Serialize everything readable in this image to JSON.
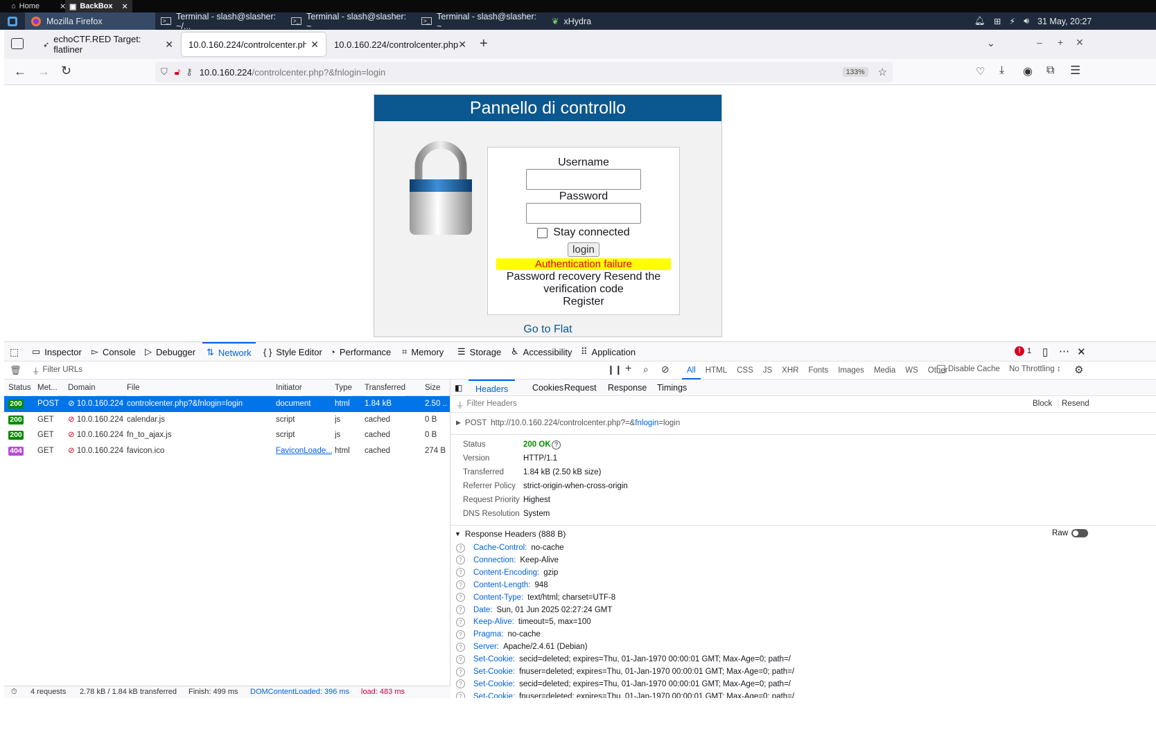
{
  "topstrip": {
    "tab1": "Home",
    "tab2": "BackBox"
  },
  "taskbar": {
    "tasks": [
      "Mozilla Firefox",
      "Terminal - slash@slasher: ~/...",
      "Terminal - slash@slasher: ~",
      "Terminal - slash@slasher: ~",
      "xHydra"
    ],
    "clock": "31 May, 20:27"
  },
  "browser": {
    "tabs": [
      "echoCTF.RED Target: flatliner",
      "10.0.160.224/controlcenter.php?&",
      "10.0.160.224/controlcenter.php"
    ],
    "url_host": "10.0.160.224",
    "url_path": "/controlcenter.php?&fnlogin=login",
    "zoom": "133%"
  },
  "page": {
    "panel_title": "Pannello di controllo",
    "username_label": "Username",
    "password_label": "Password",
    "stay_connected": "Stay connected",
    "login_button": "login",
    "error": "Authentication failure",
    "links_line1": "Password recovery Resend the",
    "links_line2": "verification code",
    "register": "Register",
    "go_to_flat": "Go to Flat"
  },
  "devtools": {
    "tabs": [
      "Inspector",
      "Console",
      "Debugger",
      "Network",
      "Style Editor",
      "Performance",
      "Memory",
      "Storage",
      "Accessibility",
      "Application"
    ],
    "error_count": "1",
    "filter_placeholder": "Filter URLs",
    "type_filters": [
      "All",
      "HTML",
      "CSS",
      "JS",
      "XHR",
      "Fonts",
      "Images",
      "Media",
      "WS",
      "Other"
    ],
    "disable_cache": "Disable Cache",
    "throttling": "No Throttling ↕",
    "columns": [
      "Status",
      "Met...",
      "Domain",
      "File",
      "Initiator",
      "Type",
      "Transferred",
      "Size"
    ],
    "requests": [
      {
        "status": "200",
        "method": "POST",
        "domain": "10.0.160.224",
        "file": "controlcenter.php?&fnlogin=login",
        "initiator": "document",
        "type": "html",
        "transferred": "1.84 kB",
        "size": "2.50 ..."
      },
      {
        "status": "200",
        "method": "GET",
        "domain": "10.0.160.224",
        "file": "calendar.js",
        "initiator": "script",
        "type": "js",
        "transferred": "cached",
        "size": "0 B"
      },
      {
        "status": "200",
        "method": "GET",
        "domain": "10.0.160.224",
        "file": "fn_to_ajax.js",
        "initiator": "script",
        "type": "js",
        "transferred": "cached",
        "size": "0 B"
      },
      {
        "status": "404",
        "method": "GET",
        "domain": "10.0.160.224",
        "file": "favicon.ico",
        "initiator": "FaviconLoade...",
        "type": "html",
        "transferred": "cached",
        "size": "274 B"
      }
    ],
    "status_colors": {
      "200": "#058b00",
      "404": "#b84bd8"
    },
    "statusbar": {
      "requests": "4 requests",
      "transferred": "2.78 kB / 1.84 kB transferred",
      "finish": "Finish: 499 ms",
      "dcl": "DOMContentLoaded: 396 ms",
      "load": "load: 483 ms"
    },
    "details": {
      "tabs": [
        "Headers",
        "Cookies",
        "Request",
        "Response",
        "Timings"
      ],
      "filter_placeholder": "Filter Headers",
      "block": "Block",
      "resend": "Resend",
      "request_method": "POST",
      "request_url_prefix": "http://10.0.160.224/controlcenter.php?=&",
      "request_url_param": "fnlogin",
      "request_url_suffix": "=login",
      "summary": [
        {
          "k": "Status",
          "v": "200 OK"
        },
        {
          "k": "Version",
          "v": "HTTP/1.1"
        },
        {
          "k": "Transferred",
          "v": "1.84 kB (2.50 kB size)"
        },
        {
          "k": "Referrer Policy",
          "v": "strict-origin-when-cross-origin"
        },
        {
          "k": "Request Priority",
          "v": "Highest"
        },
        {
          "k": "DNS Resolution",
          "v": "System"
        }
      ],
      "response_headers_title": "Response Headers (888 B)",
      "raw": "Raw",
      "headers": [
        {
          "k": "Cache-Control:",
          "v": "no-cache"
        },
        {
          "k": "Connection:",
          "v": "Keep-Alive"
        },
        {
          "k": "Content-Encoding:",
          "v": "gzip"
        },
        {
          "k": "Content-Length:",
          "v": "948"
        },
        {
          "k": "Content-Type:",
          "v": "text/html; charset=UTF-8"
        },
        {
          "k": "Date:",
          "v": "Sun, 01 Jun 2025 02:27:24 GMT"
        },
        {
          "k": "Keep-Alive:",
          "v": "timeout=5, max=100"
        },
        {
          "k": "Pragma:",
          "v": "no-cache"
        },
        {
          "k": "Server:",
          "v": "Apache/2.4.61 (Debian)"
        },
        {
          "k": "Set-Cookie:",
          "v": "secid=deleted; expires=Thu, 01-Jan-1970 00:00:01 GMT; Max-Age=0; path=/"
        },
        {
          "k": "Set-Cookie:",
          "v": "fnuser=deleted; expires=Thu, 01-Jan-1970 00:00:01 GMT; Max-Age=0; path=/"
        },
        {
          "k": "Set-Cookie:",
          "v": "secid=deleted; expires=Thu, 01-Jan-1970 00:00:01 GMT; Max-Age=0; path=/"
        },
        {
          "k": "Set-Cookie:",
          "v": "fnuser=deleted; expires=Thu, 01-Jan-1970 00:00:01 GMT; Max-Age=0; path=/"
        }
      ]
    }
  }
}
